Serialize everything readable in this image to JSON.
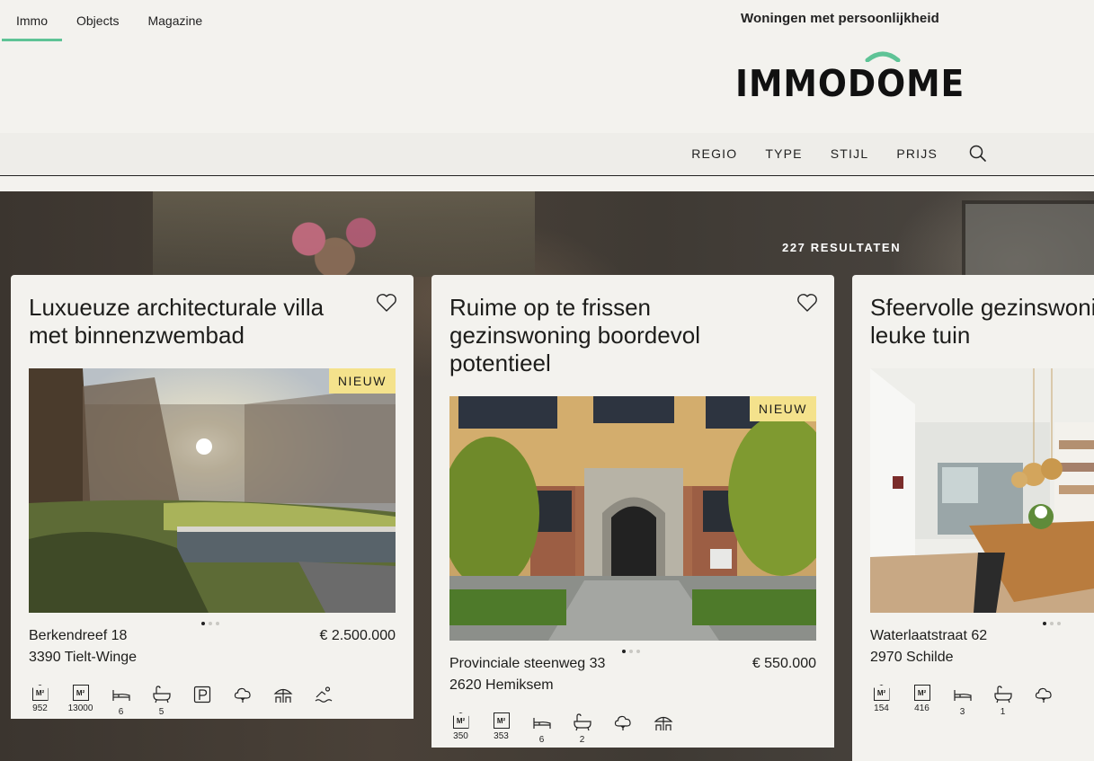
{
  "top_tabs": [
    {
      "label": "Immo",
      "active": true
    },
    {
      "label": "Objects",
      "active": false
    },
    {
      "label": "Magazine",
      "active": false
    }
  ],
  "tagline": "Woningen met persoonlijkheid",
  "logo": {
    "text": "IMMODOME",
    "accent": "#5ec396"
  },
  "nav": {
    "items": [
      "REGIO",
      "TYPE",
      "STIJL",
      "PRIJS"
    ],
    "search_icon": "search-icon"
  },
  "results": "227 RESULTATEN",
  "colors": {
    "accent": "#5ec396",
    "badge": "#f4e28c",
    "background": "#f3f2ee"
  },
  "cards": [
    {
      "title": "Luxueuze architecturale villa met binnenzwembad",
      "badge": "NIEUW",
      "street": "Berkendreef 18",
      "city": "3390 Tielt-Winge",
      "price": "€ 2.500.000",
      "photo_index": {
        "current": 1,
        "total": 3
      },
      "features": [
        {
          "icon": "house-area-icon",
          "value": "952"
        },
        {
          "icon": "plot-area-icon",
          "value": "13000"
        },
        {
          "icon": "bed-icon",
          "value": "6"
        },
        {
          "icon": "bath-icon",
          "value": "5"
        },
        {
          "icon": "parking-icon",
          "value": ""
        },
        {
          "icon": "garden-icon",
          "value": ""
        },
        {
          "icon": "terrace-icon",
          "value": ""
        },
        {
          "icon": "swimming-pool-icon",
          "value": ""
        }
      ]
    },
    {
      "title": "Ruime op te frissen gezinswoning boordevol potentieel",
      "badge": "NIEUW",
      "street": "Provinciale steenweg 33",
      "city": "2620 Hemiksem",
      "price": "€ 550.000",
      "photo_index": {
        "current": 1,
        "total": 3
      },
      "features": [
        {
          "icon": "house-area-icon",
          "value": "350"
        },
        {
          "icon": "plot-area-icon",
          "value": "353"
        },
        {
          "icon": "bed-icon",
          "value": "6"
        },
        {
          "icon": "bath-icon",
          "value": "2"
        },
        {
          "icon": "garden-icon",
          "value": ""
        },
        {
          "icon": "terrace-icon",
          "value": ""
        }
      ]
    },
    {
      "title": "Sfeervolle gezinswoning met leuke tuin",
      "badge": "",
      "street": "Waterlaatstraat 62",
      "city": "2970 Schilde",
      "price": "",
      "photo_index": {
        "current": 1,
        "total": 3
      },
      "features": [
        {
          "icon": "house-area-icon",
          "value": "154"
        },
        {
          "icon": "plot-area-icon",
          "value": "416"
        },
        {
          "icon": "bed-icon",
          "value": "3"
        },
        {
          "icon": "bath-icon",
          "value": "1"
        },
        {
          "icon": "garden-icon",
          "value": ""
        }
      ]
    }
  ]
}
